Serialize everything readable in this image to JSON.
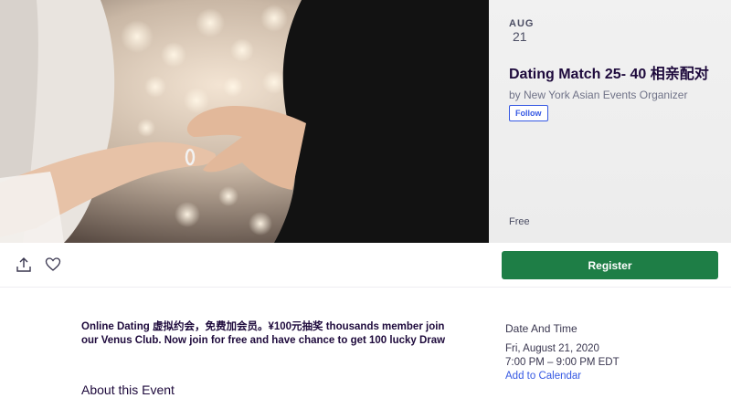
{
  "event": {
    "month": "AUG",
    "day": "21",
    "title": "Dating Match 25- 40 相亲配对",
    "organizer": "by New York Asian Events Organizer",
    "follow_label": "Follow",
    "price": "Free"
  },
  "actions": {
    "share_icon": "share-icon",
    "like_icon": "heart-icon",
    "register_label": "Register"
  },
  "description": "Online Dating 虚拟约会，免费加会员。¥100元抽奖 thousands member join our Venus Club. Now join for free and have chance to get 100 lucky Draw",
  "about_heading": "About this Event",
  "date_and_time": {
    "heading": "Date And Time",
    "date": "Fri, August 21, 2020",
    "time": "7:00 PM – 9:00 PM EDT",
    "add_to_calendar": "Add to Calendar"
  },
  "colors": {
    "register": "#1e7e46",
    "link": "#3659e3",
    "panel_bg": "#efefef"
  }
}
